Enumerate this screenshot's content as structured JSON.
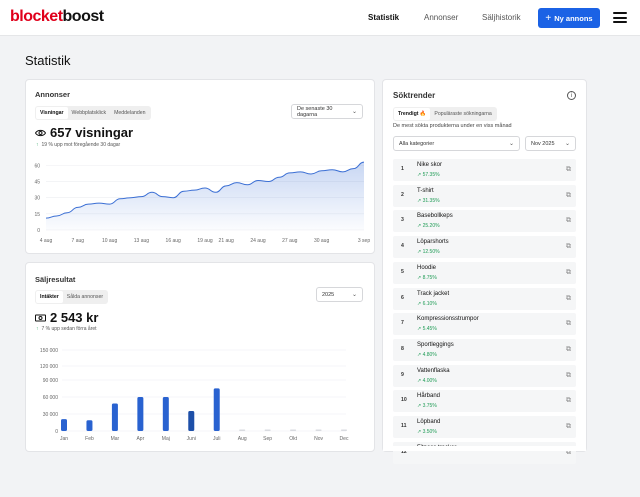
{
  "header": {
    "logo_part1": "blocket",
    "logo_part2": "boost",
    "nav": [
      "Statistik",
      "Annonser",
      "Säljhistorik"
    ],
    "cta_icon": "+",
    "cta_label": "Ny annons"
  },
  "page_title": "Statistik",
  "annonser": {
    "title": "Annonser",
    "tabs": [
      "Visningar",
      "Webbplatsklick",
      "Meddelanden"
    ],
    "period": "De senaste 30 dagarna",
    "total": "657 visningar",
    "change": "19 % upp mot föregående 30 dagar",
    "chart_data": {
      "type": "area",
      "x": [
        "4 aug",
        "5 aug",
        "6 aug",
        "7 aug",
        "8 aug",
        "9 aug",
        "10 aug",
        "11 aug",
        "12 aug",
        "13 aug",
        "14 aug",
        "15 aug",
        "16 aug",
        "17 aug",
        "18 aug",
        "19 aug",
        "20 aug",
        "21 aug",
        "22 aug",
        "23 aug",
        "24 aug",
        "25 aug",
        "26 aug",
        "27 aug",
        "28 aug",
        "29 aug",
        "30 aug",
        "31 aug",
        "1 sep",
        "2 sep",
        "3 sep"
      ],
      "values": [
        11,
        13,
        16,
        21,
        24,
        25,
        24,
        29,
        30,
        31,
        35,
        31,
        30,
        36,
        37,
        39,
        35,
        41,
        44,
        42,
        46,
        45,
        49,
        53,
        54,
        52,
        55,
        56,
        54,
        57,
        63
      ],
      "xticks": [
        "4 aug",
        "7 aug",
        "10 aug",
        "13 aug",
        "16 aug",
        "19 aug",
        "21 aug",
        "24 aug",
        "27 aug",
        "30 aug",
        "3 sep"
      ],
      "yticks": [
        0,
        15,
        30,
        45,
        60
      ],
      "ylim": [
        0,
        65
      ],
      "color": "#3b6fd4"
    }
  },
  "saljresultat": {
    "title": "Säljresultat",
    "tabs": [
      "Intäkter",
      "Sålda annonser"
    ],
    "year": "2025",
    "total": "2 543 kr",
    "change": "7 % upp sedan förra året",
    "chart_data": {
      "type": "bar",
      "categories": [
        "Jan",
        "Feb",
        "Mar",
        "Apr",
        "Maj",
        "Juni",
        "Juli",
        "Aug",
        "Sep",
        "Okt",
        "Nov",
        "Dec"
      ],
      "values": [
        22000,
        20000,
        51000,
        63000,
        63000,
        37000,
        79000,
        0,
        0,
        0,
        0,
        0
      ],
      "yticks": [
        "0",
        "15 000",
        "30 000",
        "60 000",
        "90 000",
        "120 000",
        "150 000"
      ],
      "ylim": [
        0,
        150000
      ],
      "color": "#2962d0",
      "current_color": "#1d4fa8",
      "empty_color": "#d9dbe0"
    }
  },
  "soktrender": {
    "title": "Söktrender",
    "tabs": [
      "Trendigt 🔥",
      "Populäraste sökningarna"
    ],
    "description": "De mest sökta produkterna under en viss månad",
    "category": "Alla kategorier",
    "month": "Nov 2025",
    "items": [
      {
        "rank": "1",
        "name": "Nike skor",
        "pct": "57.35%"
      },
      {
        "rank": "2",
        "name": "T-shirt",
        "pct": "31.35%"
      },
      {
        "rank": "3",
        "name": "Basebollkeps",
        "pct": "25.20%"
      },
      {
        "rank": "4",
        "name": "Löparshorts",
        "pct": "12.50%"
      },
      {
        "rank": "5",
        "name": "Hoodie",
        "pct": "8.75%"
      },
      {
        "rank": "6",
        "name": "Track jacket",
        "pct": "6.10%"
      },
      {
        "rank": "7",
        "name": "Kompressionsstrumpor",
        "pct": "5.45%"
      },
      {
        "rank": "8",
        "name": "Sportleggings",
        "pct": "4.80%"
      },
      {
        "rank": "9",
        "name": "Vattenflaska",
        "pct": "4.00%"
      },
      {
        "rank": "10",
        "name": "Hårband",
        "pct": "3.75%"
      },
      {
        "rank": "11",
        "name": "Löpband",
        "pct": "3.50%"
      },
      {
        "rank": "12",
        "name": "Fitness tracker",
        "pct": ""
      }
    ]
  }
}
